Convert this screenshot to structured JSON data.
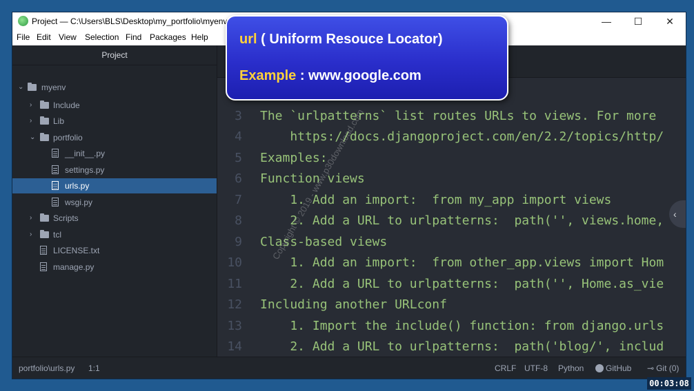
{
  "window": {
    "title": "Project — C:\\Users\\BLS\\Desktop\\my_portfolio\\myenv -",
    "minimize_glyph": "—",
    "maximize_glyph": "☐",
    "close_glyph": "✕"
  },
  "menu": {
    "items": [
      "File",
      "Edit",
      "View",
      "Selection",
      "Find",
      "Packages",
      "Help"
    ]
  },
  "sidebar": {
    "title": "Project",
    "tree": [
      {
        "label": "myenv",
        "type": "folder",
        "expanded": true,
        "depth": 0
      },
      {
        "label": "Include",
        "type": "folder",
        "expanded": false,
        "depth": 1
      },
      {
        "label": "Lib",
        "type": "folder",
        "expanded": false,
        "depth": 1
      },
      {
        "label": "portfolio",
        "type": "folder",
        "expanded": true,
        "depth": 1
      },
      {
        "label": "__init__.py",
        "type": "file",
        "depth": 2
      },
      {
        "label": "settings.py",
        "type": "file",
        "depth": 2
      },
      {
        "label": "urls.py",
        "type": "file",
        "depth": 2,
        "selected": true
      },
      {
        "label": "wsgi.py",
        "type": "file",
        "depth": 2
      },
      {
        "label": "Scripts",
        "type": "folder",
        "expanded": false,
        "depth": 1
      },
      {
        "label": "tcl",
        "type": "folder",
        "expanded": false,
        "depth": 1
      },
      {
        "label": "LICENSE.txt",
        "type": "file",
        "depth": 1
      },
      {
        "label": "manage.py",
        "type": "file",
        "depth": 1
      }
    ]
  },
  "editor": {
    "lines": [
      {
        "n": "3",
        "text": "The `urlpatterns` list routes URLs to views. For more"
      },
      {
        "n": "4",
        "text": "    https://docs.djangoproject.com/en/2.2/topics/http/"
      },
      {
        "n": "5",
        "text": "Examples:"
      },
      {
        "n": "6",
        "text": "Function views"
      },
      {
        "n": "7",
        "text": "    1. Add an import:  from my_app import views"
      },
      {
        "n": "8",
        "text": "    2. Add a URL to urlpatterns:  path('', views.home,"
      },
      {
        "n": "9",
        "text": "Class-based views"
      },
      {
        "n": "10",
        "text": "    1. Add an import:  from other_app.views import Hom"
      },
      {
        "n": "11",
        "text": "    2. Add a URL to urlpatterns:  path('', Home.as_vie"
      },
      {
        "n": "12",
        "text": "Including another URLconf"
      },
      {
        "n": "13",
        "text": "    1. Import the include() function: from django.urls"
      },
      {
        "n": "14",
        "text": "    2. Add a URL to urlpatterns:  path('blog/', includ"
      }
    ],
    "code_color": "#98c379",
    "line_number_color": "#495162"
  },
  "statusbar": {
    "file_path": "portfolio\\urls.py",
    "cursor": "1:1",
    "line_ending": "CRLF",
    "encoding": "UTF-8",
    "grammar": "Python",
    "github": "GitHub",
    "git": "Git (0)"
  },
  "callout": {
    "line1_keyword": "url",
    "line1_text": " ( Uniform Resouce Locator)",
    "line2_keyword": "Example",
    "line2_text": " : www.google.com",
    "keyword_color": "#ffd23a"
  },
  "watermark": "Copyright © 2019 - www.p30download.com",
  "timestamp": "00:03:08"
}
